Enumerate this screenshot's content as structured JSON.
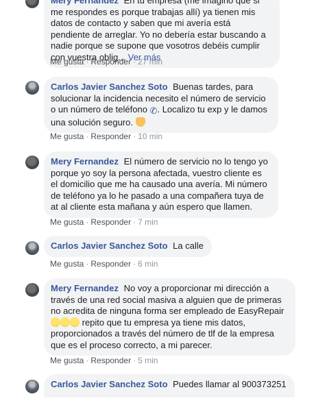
{
  "comments": [
    {
      "author": "Mery Fernandez",
      "text": "En tu empresa (me imagino que si me respondes es porque trabajas allí) ya tienen mis datos de contacto y saben que mi avería está pendiente de arreglar. Yo no debería estar buscando a nadie porque se supone que vosotros debéis cumplir con vuestra oblig...",
      "see_more": "Ver más",
      "like": "Me gusta",
      "reply": "Responder",
      "time": "27 min"
    },
    {
      "author": "Carlos Javier Sanchez Soto",
      "text": "Buenas tardes, para solucionar la incidencia necesito el número de servicio o un número de teléfono",
      "text_after": ". Localizo tu exp y le damos una solución seguro.",
      "like": "Me gusta",
      "reply": "Responder",
      "time": "10 min"
    },
    {
      "author": "Mery Fernandez",
      "text": "El número de servicio no lo tengo yo porque yo soy la persona afectada, vuestro cliente es el domicilio que me ha causado una avería. Mi número de teléfono ya lo he pasado a una compañera tuya de at al cliente esta mañana y aún espero que llamen.",
      "like": "Me gusta",
      "reply": "Responder",
      "time": "7 min"
    },
    {
      "author": "Carlos Javier Sanchez Soto",
      "text": "La calle",
      "like": "Me gusta",
      "reply": "Responder",
      "time": "6 min"
    },
    {
      "author": "Mery Fernandez",
      "text": "No voy a proporcionar mi dirección a través de una red social masiva a alguien que de primeras no acredita de ninguna forma ser empleado de EasyRepair",
      "text_after": "repito que tu empresa ya tiene mis datos, proporcionados a través del número de tlf de la empresa que es el proceso correcto, a mi parecer.",
      "like": "Me gusta",
      "reply": "Responder",
      "time": "5 min"
    },
    {
      "author": "Carlos Javier Sanchez Soto",
      "text": "Puedes llamar al 900373251"
    }
  ],
  "icons": {
    "phone": "phone-icon",
    "pointing_hand": "pointing-hand-emoji",
    "laughing": "laughing-emoji"
  },
  "colors": {
    "author": "#385898",
    "bubble": "#f2f3f5",
    "meta": "#90949c"
  }
}
